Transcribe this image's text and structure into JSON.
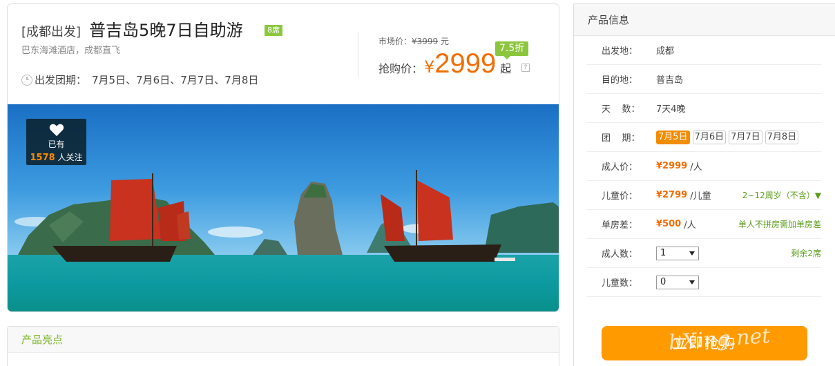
{
  "header": {
    "origin_tag": "[成都出发]",
    "title": "普吉岛5晚7日自助游",
    "seat_badge": "8席",
    "subtitle": "巴东海滩酒店，成都直飞",
    "dates_label": "出发团期：",
    "dates_value": "7月5日、7月6日、7月7日、7月8日"
  },
  "pricing": {
    "market_label": "市场价：",
    "market_value": "¥3999",
    "market_unit": "元",
    "discount": "7.5折",
    "sale_label": "抢购价：",
    "currency": "¥",
    "sale_amount": "2999",
    "sale_suffix": "起",
    "help": "?"
  },
  "hero": {
    "follow_line1": "已有",
    "follow_count": "1578",
    "follow_suffix": "人关注"
  },
  "highlights": {
    "title": "产品亮点"
  },
  "product_info": {
    "title": "产品信息",
    "rows": {
      "origin": {
        "label": "出发地：",
        "value": "成都"
      },
      "destination": {
        "label": "目的地：",
        "value": "普吉岛"
      },
      "days": {
        "label": "天    数：",
        "value": "7天4晚"
      },
      "group": {
        "label": "团    期：",
        "dates": [
          "7月5日",
          "7月6日",
          "7月7日",
          "7月8日"
        ]
      },
      "adult_price": {
        "label": "成人价：",
        "value": "¥2999",
        "unit": "/人"
      },
      "child_price": {
        "label": "儿童价：",
        "value": "¥2799",
        "unit": "/儿童",
        "note": "2~12周岁（不含）▼"
      },
      "single_room": {
        "label": "单房差：",
        "value": "¥500",
        "unit": "/人",
        "note": "单人不拼房需加单房差"
      },
      "adults": {
        "label": "成人数：",
        "selected": "1",
        "note": "剩余2席"
      },
      "children": {
        "label": "儿童数：",
        "selected": "0"
      }
    },
    "buy_button": "立即抢购"
  },
  "watermark": "bXing.net",
  "colors": {
    "accent_orange": "#f26d00",
    "button_orange": "#ff9a00",
    "badge_green": "#8cc63f"
  }
}
